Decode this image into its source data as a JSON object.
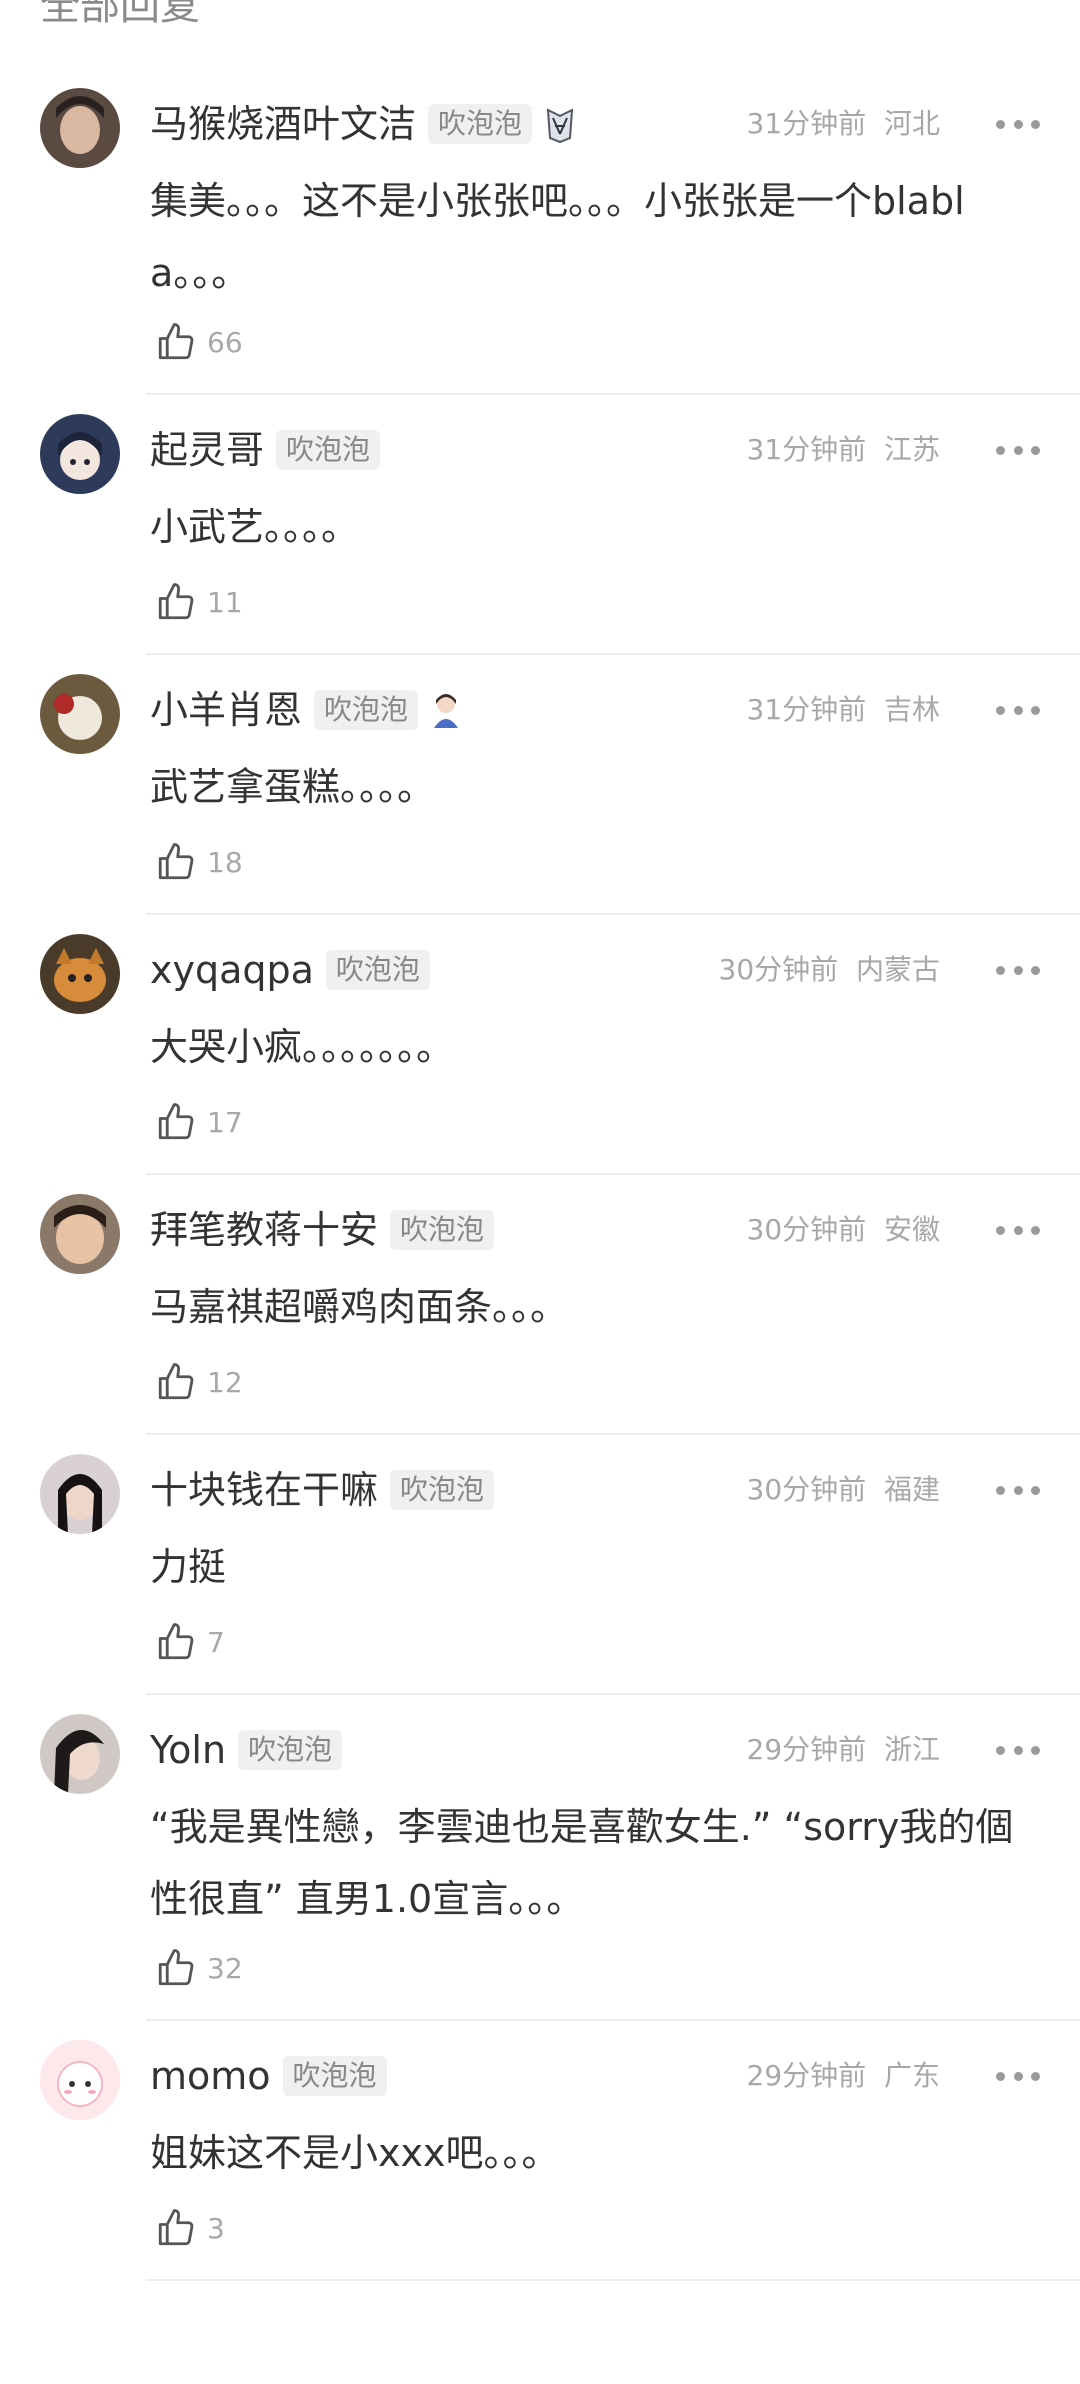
{
  "section_title": "全部回复",
  "badge_label": "吹泡泡",
  "comments": [
    {
      "username": "马猴烧酒叶文洁",
      "time": "31分钟前",
      "location": "河北",
      "text": "集美。。。这不是小张张吧。。。小张张是一个blabla。。。",
      "likes": "66",
      "medal": "wings-badge-icon"
    },
    {
      "username": "起灵哥",
      "time": "31分钟前",
      "location": "江苏",
      "text": "小武艺。。。。",
      "likes": "11"
    },
    {
      "username": "小羊肖恩",
      "time": "31分钟前",
      "location": "吉林",
      "text": "武艺拿蛋糕。。。。",
      "likes": "18",
      "medal": "girl-badge-icon"
    },
    {
      "username": "xyqaqpa",
      "time": "30分钟前",
      "location": "内蒙古",
      "text": "大哭小疯。。。。。。。",
      "likes": "17"
    },
    {
      "username": "拜笔教蒋十安",
      "time": "30分钟前",
      "location": "安徽",
      "text": "马嘉祺超嚼鸡肉面条。。。",
      "likes": "12"
    },
    {
      "username": "十块钱在干嘛",
      "time": "30分钟前",
      "location": "福建",
      "text": "力挺",
      "likes": "7"
    },
    {
      "username": "Yoln",
      "time": "29分钟前",
      "location": "浙江",
      "text": "“我是異性戀，李雲迪也是喜歡女生.” “sorry我的個性很直” 直男1.0宣言。。。",
      "likes": "32"
    },
    {
      "username": "momo",
      "time": "29分钟前",
      "location": "广东",
      "text": "姐妹这不是小xxx吧。。。",
      "likes": "3"
    }
  ],
  "colors": {
    "text": "#333333",
    "muted": "#a8a8a8",
    "badge_bg": "#f0f0f0",
    "divider": "#ececec"
  }
}
